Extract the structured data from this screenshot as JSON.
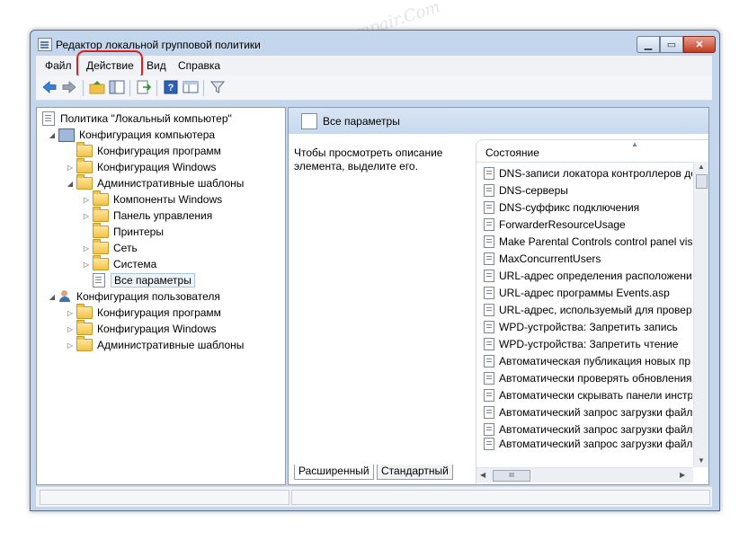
{
  "window": {
    "title": "Редактор локальной групповой политики",
    "buttons": {
      "minimize": "▁",
      "maximize": "▭",
      "close": "✕"
    }
  },
  "menu": {
    "items": [
      "Файл",
      "Действие",
      "Вид",
      "Справка"
    ],
    "highlighted": "Действие",
    "highlight_color": "#e11d1d"
  },
  "toolbar": {
    "icons": [
      "back-icon",
      "forward-icon",
      "up-folder-icon",
      "show-hide-tree-icon",
      "export-list-icon",
      "help-icon",
      "extended-view-icon",
      "filter-icon"
    ]
  },
  "tree": {
    "root": "Политика \"Локальный компьютер\"",
    "items": [
      {
        "label": "Конфигурация компьютера",
        "icon": "computer-icon",
        "expanded": true
      },
      {
        "label": "Конфигурация программ",
        "icon": "folder-icon"
      },
      {
        "label": "Конфигурация Windows",
        "icon": "folder-icon"
      },
      {
        "label": "Административные шаблоны",
        "icon": "folder-icon",
        "expanded": true
      },
      {
        "label": "Компоненты Windows",
        "icon": "folder-icon"
      },
      {
        "label": "Панель управления",
        "icon": "folder-icon"
      },
      {
        "label": "Принтеры",
        "icon": "folder-icon"
      },
      {
        "label": "Сеть",
        "icon": "folder-icon"
      },
      {
        "label": "Система",
        "icon": "folder-icon"
      },
      {
        "label": "Все параметры",
        "icon": "settings-list-icon",
        "selected": true
      },
      {
        "label": "Конфигурация пользователя",
        "icon": "user-icon",
        "expanded": true
      },
      {
        "label": "Конфигурация программ",
        "icon": "folder-icon"
      },
      {
        "label": "Конфигурация Windows",
        "icon": "folder-icon"
      },
      {
        "label": "Административные шаблоны",
        "icon": "folder-icon"
      }
    ]
  },
  "right": {
    "header": "Все параметры",
    "description": "Чтобы просмотреть описание элемента, выделите его.",
    "column": "Состояние",
    "rows": [
      "DNS-записи локатора контроллеров до",
      "DNS-серверы",
      "DNS-суффикс подключения",
      "ForwarderResourceUsage",
      "Make Parental Controls control panel visi",
      "MaxConcurrentUsers",
      "URL-адрес определения расположения",
      "URL-адрес программы Events.asp",
      "URL-адрес, используемый для проверк",
      "WPD-устройства: Запретить запись",
      "WPD-устройства: Запретить чтение",
      "Автоматическая публикация новых пр",
      "Автоматически проверять обновления",
      "Автоматически скрывать панели инстр",
      "Автоматический запрос загрузки файл",
      "Автоматический запрос загрузки файл",
      "Автоматический запрос загрузки файл"
    ],
    "scroll_thumb_label": "III",
    "tabs": [
      "Расширенный",
      "Стандартный"
    ]
  },
  "watermark": "Soringpcrepair.Com"
}
